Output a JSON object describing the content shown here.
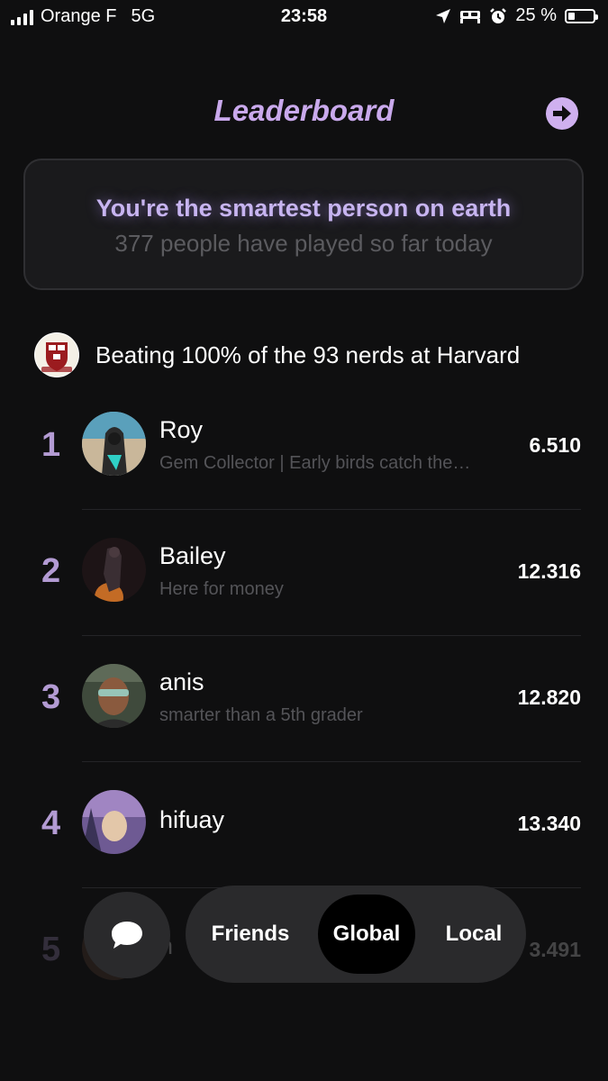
{
  "status_bar": {
    "carrier": "Orange F",
    "network": "5G",
    "time": "23:58",
    "battery": "25 %",
    "battery_level": 0.25
  },
  "header": {
    "title": "Leaderboard",
    "exit_icon": "arrow-right-circle-icon"
  },
  "banner": {
    "headline": "You're the smartest person on earth",
    "subtext": "377 people have played so far today"
  },
  "school": {
    "text": "Beating 100% of the 93 nerds at Harvard",
    "icon": "harvard-crest"
  },
  "leaderboard": [
    {
      "rank": "1",
      "name": "Roy",
      "bio": "Gem Collector | Early birds catch the…",
      "score": "6.510"
    },
    {
      "rank": "2",
      "name": "Bailey",
      "bio": "Here for money",
      "score": "12.316"
    },
    {
      "rank": "3",
      "name": "anis",
      "bio": "smarter than a 5th grader",
      "score": "12.820"
    },
    {
      "rank": "4",
      "name": "hifuay",
      "bio": "",
      "score": "13.340"
    },
    {
      "rank": "5",
      "name": "h",
      "bio": "",
      "score": "3.491"
    }
  ],
  "nav": {
    "chat_icon": "chat-bubble-icon",
    "tabs": [
      "Friends",
      "Global",
      "Local"
    ],
    "selected": "Global"
  },
  "colors": {
    "background": "#0f0f10",
    "accent": "#c9a9ec",
    "rank": "#b39bd3"
  }
}
